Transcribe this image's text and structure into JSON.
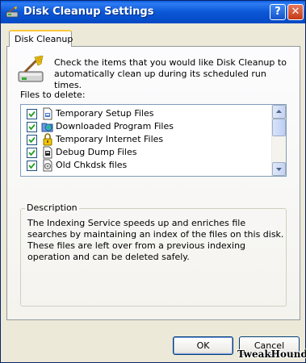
{
  "window": {
    "title": "Disk Cleanup Settings",
    "help_label": "?",
    "close_label": "✕",
    "title_icon": "disk-cleanup-app-icon"
  },
  "tab": {
    "label": "Disk Cleanup"
  },
  "intro": {
    "text": "Check the items that you would like Disk Cleanup to automatically clean up during its scheduled run times.",
    "icon": "broom-drive-icon"
  },
  "files": {
    "label": "Files to delete:",
    "items": [
      {
        "label": "Temporary Setup Files",
        "checked": true,
        "icon": "setup-file-icon"
      },
      {
        "label": "Downloaded Program Files",
        "checked": true,
        "icon": "globe-folder-icon"
      },
      {
        "label": "Temporary Internet Files",
        "checked": true,
        "icon": "lock-icon"
      },
      {
        "label": "Debug Dump Files",
        "checked": true,
        "icon": "dump-file-icon"
      },
      {
        "label": "Old Chkdsk files",
        "checked": true,
        "icon": "chkdsk-file-icon"
      }
    ]
  },
  "description": {
    "legend": "Description",
    "text": "The Indexing Service speeds up and enriches file searches by maintaining an index of the files on this disk. These files are left over from a previous indexing operation and can be deleted safely."
  },
  "buttons": {
    "ok": "OK",
    "cancel": "Cancel"
  },
  "watermark": "TweakHound",
  "colors": {
    "titlebar": "#0B57D6",
    "dialog_bg": "#ECE9D8",
    "tab_highlight": "#FFC83C"
  }
}
